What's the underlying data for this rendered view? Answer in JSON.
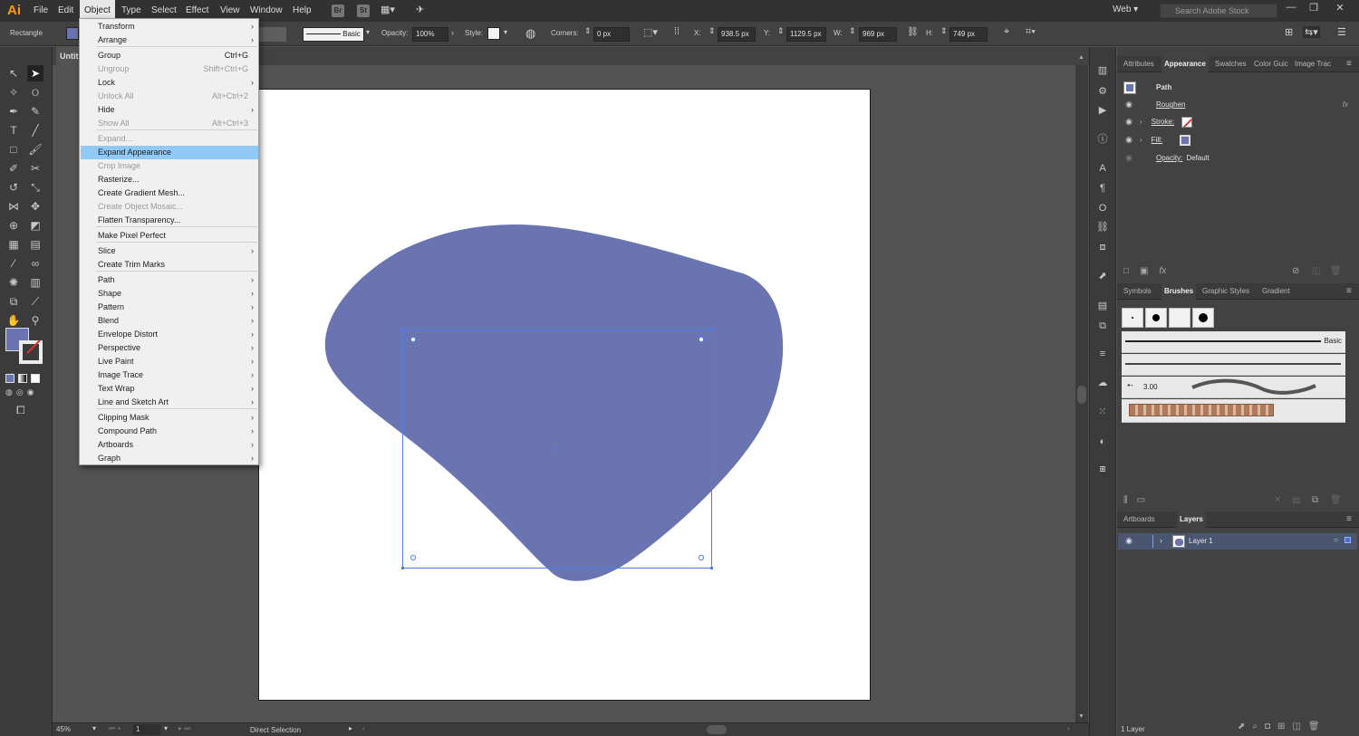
{
  "app": {
    "logo": "Ai"
  },
  "menubar": {
    "items": [
      "File",
      "Edit",
      "Object",
      "Type",
      "Select",
      "Effect",
      "View",
      "Window",
      "Help"
    ],
    "bridge": "Br",
    "stock": "St",
    "workspace": "Web",
    "search_placeholder": "Search Adobe Stock"
  },
  "controlbar": {
    "selection_label": "Rectangle",
    "stroke_profile": "Basic",
    "opacity_label": "Opacity:",
    "opacity_value": "100%",
    "style_label": "Style:",
    "corners_label": "Corners:",
    "corners_value": "0 px",
    "x_label": "X:",
    "x_value": "938.5 px",
    "y_label": "Y:",
    "y_value": "1129.5 px",
    "w_label": "W:",
    "w_value": "969 px",
    "h_label": "H:",
    "h_value": "749 px",
    "fill_color": "#6974b0"
  },
  "document": {
    "tab_label": "Untit"
  },
  "object_menu": {
    "items": [
      {
        "label": "Transform",
        "shortcut": "",
        "submenu": true,
        "disabled": false
      },
      {
        "label": "Arrange",
        "shortcut": "",
        "submenu": true,
        "disabled": false
      },
      {
        "label": "Group",
        "shortcut": "Ctrl+G",
        "submenu": false,
        "disabled": false
      },
      {
        "label": "Ungroup",
        "shortcut": "Shift+Ctrl+G",
        "submenu": false,
        "disabled": true
      },
      {
        "label": "Lock",
        "shortcut": "",
        "submenu": true,
        "disabled": false
      },
      {
        "label": "Unlock All",
        "shortcut": "Alt+Ctrl+2",
        "submenu": false,
        "disabled": true
      },
      {
        "label": "Hide",
        "shortcut": "",
        "submenu": true,
        "disabled": false
      },
      {
        "label": "Show All",
        "shortcut": "Alt+Ctrl+3",
        "submenu": false,
        "disabled": true
      },
      {
        "label": "Expand...",
        "shortcut": "",
        "submenu": false,
        "disabled": true
      },
      {
        "label": "Expand Appearance",
        "shortcut": "",
        "submenu": false,
        "disabled": false,
        "highlighted": true
      },
      {
        "label": "Crop Image",
        "shortcut": "",
        "submenu": false,
        "disabled": true
      },
      {
        "label": "Rasterize...",
        "shortcut": "",
        "submenu": false,
        "disabled": false
      },
      {
        "label": "Create Gradient Mesh...",
        "shortcut": "",
        "submenu": false,
        "disabled": false
      },
      {
        "label": "Create Object Mosaic...",
        "shortcut": "",
        "submenu": false,
        "disabled": true
      },
      {
        "label": "Flatten Transparency...",
        "shortcut": "",
        "submenu": false,
        "disabled": false
      },
      {
        "label": "Make Pixel Perfect",
        "shortcut": "",
        "submenu": false,
        "disabled": false
      },
      {
        "label": "Slice",
        "shortcut": "",
        "submenu": true,
        "disabled": false
      },
      {
        "label": "Create Trim Marks",
        "shortcut": "",
        "submenu": false,
        "disabled": false
      },
      {
        "label": "Path",
        "shortcut": "",
        "submenu": true,
        "disabled": false
      },
      {
        "label": "Shape",
        "shortcut": "",
        "submenu": true,
        "disabled": false
      },
      {
        "label": "Pattern",
        "shortcut": "",
        "submenu": true,
        "disabled": false
      },
      {
        "label": "Blend",
        "shortcut": "",
        "submenu": true,
        "disabled": false
      },
      {
        "label": "Envelope Distort",
        "shortcut": "",
        "submenu": true,
        "disabled": false
      },
      {
        "label": "Perspective",
        "shortcut": "",
        "submenu": true,
        "disabled": false
      },
      {
        "label": "Live Paint",
        "shortcut": "",
        "submenu": true,
        "disabled": false
      },
      {
        "label": "Image Trace",
        "shortcut": "",
        "submenu": true,
        "disabled": false
      },
      {
        "label": "Text Wrap",
        "shortcut": "",
        "submenu": true,
        "disabled": false
      },
      {
        "label": "Line and Sketch Art",
        "shortcut": "",
        "submenu": true,
        "disabled": false
      },
      {
        "label": "Clipping Mask",
        "shortcut": "",
        "submenu": true,
        "disabled": false
      },
      {
        "label": "Compound Path",
        "shortcut": "",
        "submenu": true,
        "disabled": false
      },
      {
        "label": "Artboards",
        "shortcut": "",
        "submenu": true,
        "disabled": false
      },
      {
        "label": "Graph",
        "shortcut": "",
        "submenu": true,
        "disabled": false
      }
    ]
  },
  "statusbar": {
    "zoom": "45%",
    "artboard_number": "1",
    "tool": "Direct Selection"
  },
  "panels": {
    "top_tabs": [
      "Attributes",
      "Appearance",
      "Swatches",
      "Color Guic",
      "Image Trac"
    ],
    "appearance": {
      "object_type": "Path",
      "effect": "Roughen",
      "effect_icon": "fx",
      "stroke_label": "Stroke:",
      "fill_label": "Fill:",
      "opacity_label": "Opacity:",
      "opacity_value": "Default",
      "fill_color": "#6974b0"
    },
    "mid_tabs": [
      "Symbols",
      "Brushes",
      "Graphic Styles",
      "Gradient"
    ],
    "brushes": {
      "basic_label": "Basic",
      "size_label": "3.00"
    },
    "bottom_tabs": [
      "Artboards",
      "Layers"
    ],
    "layers": {
      "layer_name": "Layer 1",
      "count_label": "1 Layer"
    }
  },
  "canvas": {
    "shape_color": "#6974b0",
    "selection_color": "#4f7fe6"
  }
}
